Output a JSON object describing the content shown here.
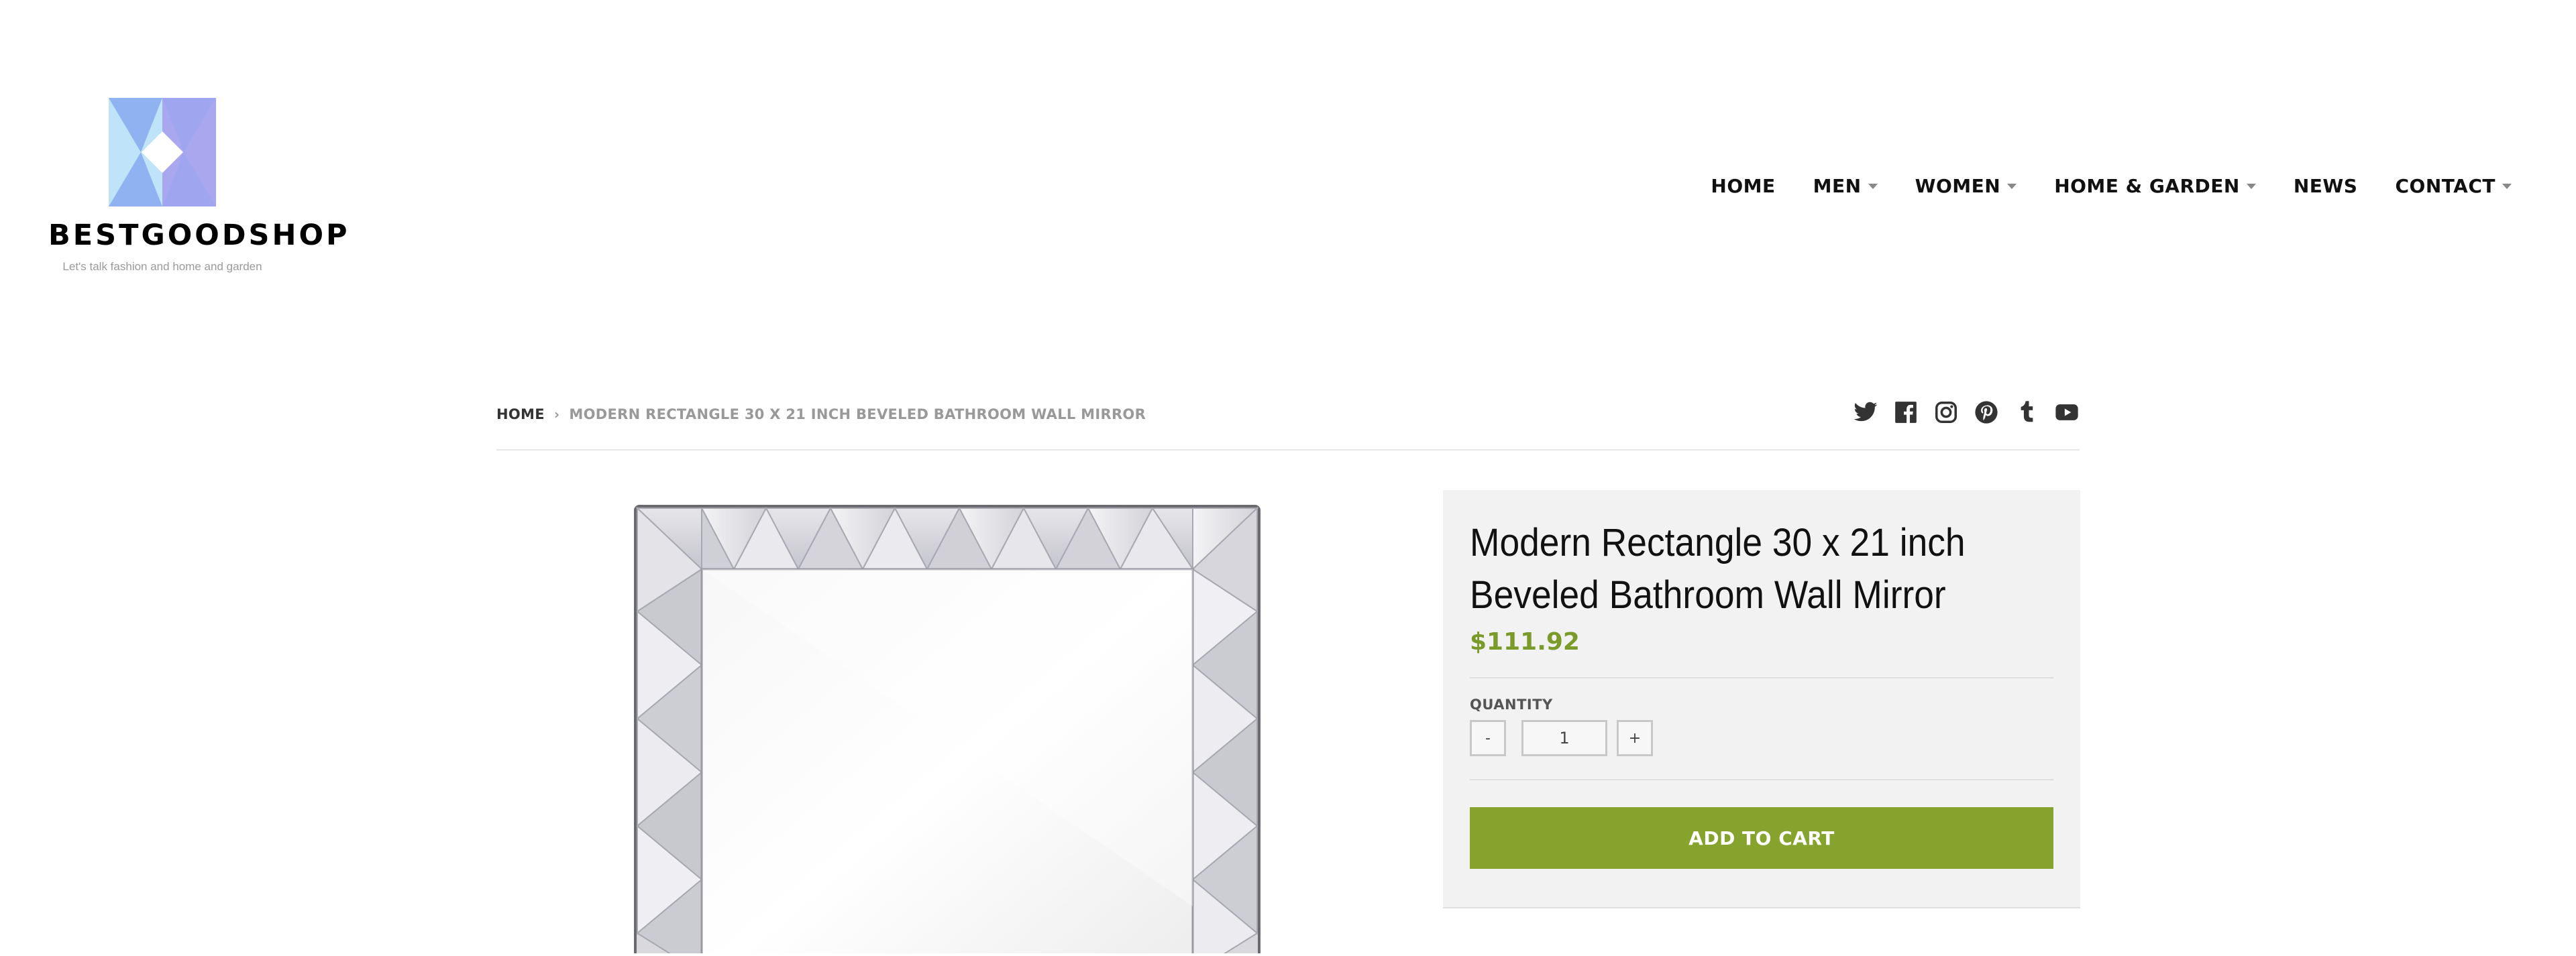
{
  "header": {
    "brand": "BESTGOODSHOP",
    "tagline": "Let's talk fashion and home and garden",
    "nav": [
      {
        "label": "HOME",
        "has_dropdown": false
      },
      {
        "label": "MEN",
        "has_dropdown": true
      },
      {
        "label": "WOMEN",
        "has_dropdown": true
      },
      {
        "label": "HOME & GARDEN",
        "has_dropdown": true
      },
      {
        "label": "NEWS",
        "has_dropdown": false
      },
      {
        "label": "CONTACT",
        "has_dropdown": true
      }
    ]
  },
  "breadcrumb": {
    "home": "HOME",
    "separator": "›",
    "current": "MODERN RECTANGLE 30 X 21 INCH BEVELED BATHROOM WALL MIRROR"
  },
  "social_icons": [
    "twitter-icon",
    "facebook-icon",
    "instagram-icon",
    "pinterest-icon",
    "tumblr-icon",
    "youtube-icon"
  ],
  "product": {
    "title": "Modern Rectangle 30 x 21 inch Beveled Bathroom Wall Mirror",
    "price": "$111.92",
    "quantity_label": "QUANTITY",
    "quantity_value": "1",
    "minus_label": "-",
    "plus_label": "+",
    "add_to_cart_label": "ADD TO CART"
  },
  "colors": {
    "accent": "#86a42d",
    "price": "#7a9a2a",
    "panel_bg": "#f2f2f2"
  }
}
